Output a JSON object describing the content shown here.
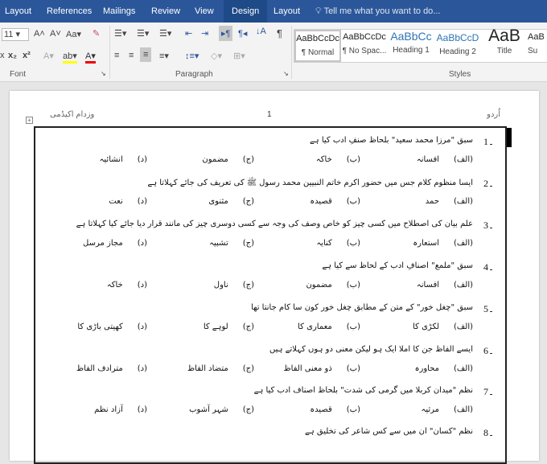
{
  "tabs": [
    "Layout",
    "References",
    "Mailings",
    "Review",
    "View",
    "Design",
    "Layout"
  ],
  "tell_me": "Tell me what you want to do...",
  "font": {
    "size": "11",
    "group": "Font"
  },
  "paragraph": {
    "group": "Paragraph"
  },
  "styles": {
    "group": "Styles",
    "items": [
      {
        "sample": "AaBbCcDc",
        "name": "¶ Normal"
      },
      {
        "sample": "AaBbCcDc",
        "name": "¶ No Spac..."
      },
      {
        "sample": "AaBbCc",
        "name": "Heading 1"
      },
      {
        "sample": "AaBbCcD",
        "name": "Heading 2"
      },
      {
        "sample": "AaB",
        "name": "Title"
      },
      {
        "sample": "AaB",
        "name": "Su"
      }
    ]
  },
  "header": {
    "left": "وزدام اکیڈمی",
    "center": "1",
    "right": "اُردو"
  },
  "labels": [
    "(الف)",
    "(ب)",
    "(ج)",
    "(د)"
  ],
  "questions": [
    {
      "num": "1۔",
      "text": "سبق \"مرزا محمد سعید\" بلحاظ صنفِ ادب کیا ہے",
      "options": [
        "افسانہ",
        "خاکہ",
        "مضمون",
        "انشائیہ"
      ]
    },
    {
      "num": "2۔",
      "text": "ایسا منظوم کلام جس میں حضور اکرم خاتم النبیین محمد رسول ﷺ کی تعریف کی جائے کہلاتا ہے",
      "options": [
        "حمد",
        "قصیدہ",
        "مثنوی",
        "نعت"
      ]
    },
    {
      "num": "3۔",
      "text": "علم بیان کی اصطلاح میں کسی چیز کو خاص وصف کی وجہ سے کسی دوسری چیز کی مانند قرار دیا جائے کیا کہلاتا ہے",
      "options": [
        "استعارہ",
        "کنایہ",
        "تشبیہ",
        "مجاز مرسل"
      ]
    },
    {
      "num": "4۔",
      "text": "سبق \"ملمع\" اصنافِ ادب کے لحاظ سے کیا ہے",
      "options": [
        "افسانہ",
        "مضمون",
        "ناول",
        "خاکہ"
      ]
    },
    {
      "num": "5۔",
      "text": "سبق \"چغل خور\" کے متن کے مطابق چغل خور کون سا کام جانتا تھا",
      "options": [
        "لکڑی کا",
        "معماری کا",
        "لوہے کا",
        "کھیتی باڑی کا"
      ]
    },
    {
      "num": "6۔",
      "text": "ایسے الفاظ جن کا املا ایک ہو لیکن معنی دو ہوں کہلاتے ہیں",
      "options": [
        "محاورہ",
        "ذو معنی الفاظ",
        "متضاد الفاظ",
        "مترادف الفاظ"
      ]
    },
    {
      "num": "7۔",
      "text": "نظم \"میدان کربلا میں گرمی کی شدت\" بلحاظ اصناف ادب کیا ہے",
      "options": [
        "مرثیہ",
        "قصیدہ",
        "شہر آشوب",
        "آزاد نظم"
      ]
    },
    {
      "num": "8۔",
      "text": "نظم \"کسان\" ان میں سے کس شاعر کی تخلیق ہے",
      "options": []
    }
  ]
}
